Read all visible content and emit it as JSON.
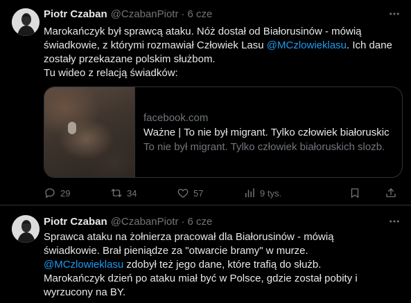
{
  "tweets": [
    {
      "author": {
        "name": "Piotr Czaban",
        "handle": "@CzabanPiotr",
        "separator": "·",
        "time": "6 cze"
      },
      "text_lines": [
        [
          "Marokańczyk był sprawcą ataku. Nóż dostał od Białorusinów - mówią"
        ],
        [
          "świadkowie, z którymi rozmawiał Człowiek Lasu ",
          "@MCzlowieklasu",
          ". Ich dane"
        ],
        [
          "zostały przekazane polskim służbom."
        ],
        [
          "Tu wideo z relacją świadków:"
        ]
      ],
      "card": {
        "domain": "facebook.com",
        "title": "Ważne | To nie był migrant. Tylko człowiek białoruskic",
        "description": "To nie był migrant. Tylko człowiek białoruskich slozb."
      },
      "stats": {
        "replies": "29",
        "retweets": "34",
        "likes": "57",
        "views": "9 tys."
      }
    },
    {
      "author": {
        "name": "Piotr Czaban",
        "handle": "@CzabanPiotr",
        "separator": "·",
        "time": "6 cze"
      },
      "text_lines": [
        [
          "Sprawca ataku na żołnierza pracował dla Białorusinów - mówią"
        ],
        [
          "świadkowie. Brał pieniądze za \"otwarcie bramy\" w murze."
        ],
        [
          "@MCzlowieklasu",
          " zdobył też jego dane, które trafią do służb."
        ],
        [
          "Marokańczyk dzień po ataku miał być w Polsce, gdzie został pobity i"
        ],
        [
          "wyrzucony na BY."
        ]
      ]
    }
  ],
  "icons": {
    "more": "more-horizontal-icon",
    "reply": "reply-icon",
    "retweet": "retweet-icon",
    "like": "heart-icon",
    "views": "views-chart-icon",
    "bookmark": "bookmark-icon",
    "share": "share-icon"
  },
  "colors": {
    "background": "#000000",
    "text": "#e7e9ea",
    "muted": "#71767b",
    "link": "#1d9bf0",
    "border": "#2f3336"
  }
}
